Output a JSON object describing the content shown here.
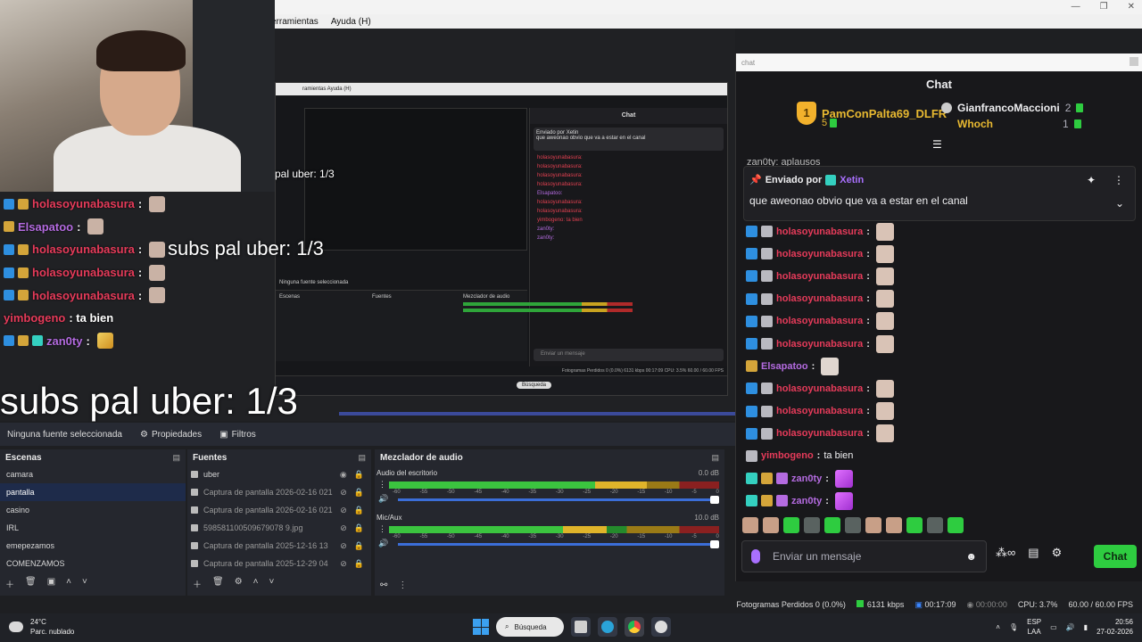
{
  "window": {
    "menu": [
      "erramientas",
      "Ayuda (H)"
    ],
    "minimize": "—",
    "maximize": "❐",
    "close": "✕"
  },
  "overlay": {
    "chat": [
      {
        "user": "holasoyunabasura",
        "sep": ":",
        "color": "#e63b5a",
        "badges": [
          "blue",
          "gold"
        ],
        "emote": "avatar"
      },
      {
        "user": "Elsapatoo",
        "sep": ":",
        "color": "#b46be0",
        "badges": [
          "gold"
        ],
        "emote": "cat"
      },
      {
        "user": "holasoyunabasura",
        "sep": ":",
        "color": "#e63b5a",
        "badges": [
          "blue",
          "gold"
        ],
        "emote": "avatar"
      },
      {
        "user": "holasoyunabasura",
        "sep": ":",
        "color": "#e63b5a",
        "badges": [
          "blue",
          "gold"
        ],
        "emote": "avatar"
      },
      {
        "user": "holasoyunabasura",
        "sep": ":",
        "color": "#e63b5a",
        "badges": [
          "blue",
          "gold"
        ],
        "emote": "avatar"
      },
      {
        "user": "yimbogeno",
        "sep": ": ta bien",
        "color": "#e63b5a",
        "badges": [],
        "emote": ""
      },
      {
        "user": "zan0ty",
        "sep": ":",
        "color": "#b46be0",
        "badges": [
          "blue",
          "gold",
          "teal"
        ],
        "emote": "feather"
      }
    ],
    "subs_big": "subs pal uber: 1/3",
    "subs_mid": "subs pal uber: 1/3",
    "subs_small": "pal uber: 1/3"
  },
  "nested": {
    "menu": "ramientas  Ayuda (H)",
    "chat_title": "Chat",
    "pin_head": "Enviado por  Xetin",
    "pin_text": "que aweonao obvio que va a estar en el canal",
    "input": "Enviar un mensaje",
    "rows": [
      "holasoyunabasura:",
      "holasoyunabasura:",
      "holasoyunabasura:",
      "holasoyunabasura:",
      "Elsapatoo:",
      "holasoyunabasura:",
      "holasoyunabasura:",
      "yimbogeno: ta bien",
      "zan0ty:",
      "zan0ty:"
    ],
    "source_hint": "Ninguna fuente seleccionada",
    "scenes_label": "Escenas",
    "sources_label": "Fuentes",
    "mixer_label": "Mezclador de audio",
    "status": "Fotogramas Perdidos 0 (0.0%)  6131 kbps  00:17:09  CPU: 3.5%  60.00 / 60.00 FPS",
    "taskbar_search": "Búsqueda"
  },
  "chatwin": {
    "url": "chat",
    "title": "Chat",
    "leaderboard": {
      "first_name": "PamConPalta69_DLFR",
      "first_rank": "1",
      "first_count": "5",
      "second_name": "GianfrancoMaccioni",
      "second_count": "2",
      "third_name": "Whoch",
      "third_count": "1"
    },
    "partial": "zan0ty: aplausos",
    "pinned": {
      "label": "Enviado por",
      "user": "Xetin",
      "text": "que aweonao obvio que va a estar en el canal"
    },
    "messages": [
      {
        "user": "holasoyunabasura",
        "color": "#e63b5a",
        "badges": [
          "b1",
          "b2"
        ],
        "text": "",
        "emote": "avatar"
      },
      {
        "user": "holasoyunabasura",
        "color": "#e63b5a",
        "badges": [
          "b1",
          "b2"
        ],
        "text": "",
        "emote": "avatar"
      },
      {
        "user": "holasoyunabasura",
        "color": "#e63b5a",
        "badges": [
          "b1",
          "b2"
        ],
        "text": "",
        "emote": "avatar"
      },
      {
        "user": "holasoyunabasura",
        "color": "#e63b5a",
        "badges": [
          "b1",
          "b2"
        ],
        "text": "",
        "emote": "avatar"
      },
      {
        "user": "holasoyunabasura",
        "color": "#e63b5a",
        "badges": [
          "b1",
          "b2"
        ],
        "text": "",
        "emote": "avatar"
      },
      {
        "user": "holasoyunabasura",
        "color": "#e63b5a",
        "badges": [
          "b1",
          "b2"
        ],
        "text": "",
        "emote": "avatar"
      },
      {
        "user": "Elsapatoo",
        "color": "#b46be0",
        "badges": [
          "b3"
        ],
        "text": "",
        "emote": "cat"
      },
      {
        "user": "holasoyunabasura",
        "color": "#e63b5a",
        "badges": [
          "b1",
          "b2"
        ],
        "text": "",
        "emote": "avatar"
      },
      {
        "user": "holasoyunabasura",
        "color": "#e63b5a",
        "badges": [
          "b1",
          "b2"
        ],
        "text": "",
        "emote": "avatar"
      },
      {
        "user": "holasoyunabasura",
        "color": "#e63b5a",
        "badges": [
          "b1",
          "b2"
        ],
        "text": "",
        "emote": "avatar"
      },
      {
        "user": "yimbogeno",
        "color": "#e63b5a",
        "badges": [
          "b2"
        ],
        "text": "ta bien",
        "emote": ""
      },
      {
        "user": "zan0ty",
        "color": "#b46be0",
        "badges": [
          "b4",
          "b3",
          "b5"
        ],
        "text": "",
        "emote": "feather"
      },
      {
        "user": "zan0ty",
        "color": "#b46be0",
        "badges": [
          "b4",
          "b3",
          "b5"
        ],
        "text": "",
        "emote": "feather"
      }
    ],
    "input_placeholder": "Enviar un mensaje",
    "send_label": "Chat"
  },
  "obs": {
    "no_source": "Ninguna fuente seleccionada",
    "properties": "Propiedades",
    "filters": "Filtros",
    "scenes_title": "Escenas",
    "scenes": [
      "camara",
      "pantalla",
      "casino",
      "IRL",
      "emepezamos",
      "COMENZAMOS"
    ],
    "selected_scene": 1,
    "sources_title": "Fuentes",
    "sources": [
      "uber",
      "Captura de pantalla 2026-02-16 021",
      "Captura de pantalla 2026-02-16 021",
      "598581100509679078 9.jpg",
      "Captura de pantalla 2025-12-16 13",
      "Captura de pantalla 2025-12-29 04"
    ],
    "mixer_title": "Mezclador de audio",
    "channels": [
      {
        "name": "Audio del escritorio",
        "db": "0.0 dB",
        "level": 0.78
      },
      {
        "name": "Mic/Aux",
        "db": "10.0 dB",
        "level": 0.66
      }
    ],
    "ticks": [
      "-60",
      "-55",
      "-50",
      "-45",
      "-40",
      "-35",
      "-30",
      "-25",
      "-20",
      "-15",
      "-10",
      "-5",
      "0"
    ]
  },
  "status": {
    "dropped": "Fotogramas Perdidos 0 (0.0%)",
    "kbps": "6131 kbps",
    "rec": "00:17:09",
    "stream": "00:00:00",
    "cpu": "CPU: 3.7%",
    "fps": "60.00 / 60.00 FPS"
  },
  "taskbar": {
    "temp": "24°C",
    "weather": "Parc. nublado",
    "search": "Búsqueda",
    "lang1": "ESP",
    "lang2": "LAA",
    "time": "20:56",
    "date": "27-02-2026"
  }
}
